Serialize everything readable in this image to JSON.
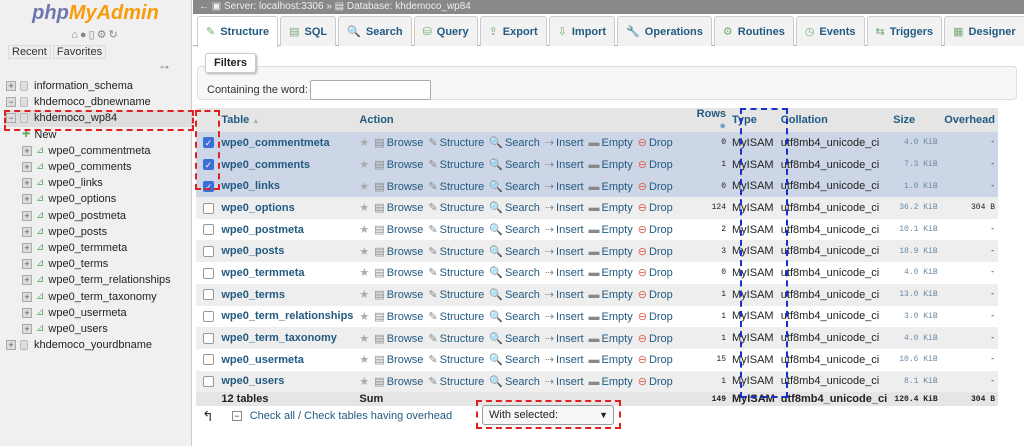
{
  "sidebar": {
    "logo_php": "php",
    "logo_ma": "MyAdmin",
    "recent": "Recent",
    "favorites": "Favorites",
    "link_icon": "chain-link-icon",
    "databases": [
      {
        "name": "information_schema",
        "expander": "+"
      },
      {
        "name": "khdemoco_dbnewname",
        "expander": "−"
      },
      {
        "name": "khdemoco_wp84",
        "expander": "−",
        "selected": true
      },
      {
        "name": "khdemoco_yourdbname",
        "expander": "+"
      }
    ],
    "new_label": "New",
    "tables": [
      "wpe0_commentmeta",
      "wpe0_comments",
      "wpe0_links",
      "wpe0_options",
      "wpe0_postmeta",
      "wpe0_posts",
      "wpe0_termmeta",
      "wpe0_terms",
      "wpe0_term_relationships",
      "wpe0_term_taxonomy",
      "wpe0_usermeta",
      "wpe0_users"
    ]
  },
  "breadcrumb": {
    "server": "Server: localhost:3306",
    "sep": "»",
    "database": "Database: khdemoco_wp84"
  },
  "tabs": [
    {
      "label": "Structure",
      "icon": "✎"
    },
    {
      "label": "SQL",
      "icon": "▤"
    },
    {
      "label": "Search",
      "icon": "🔍"
    },
    {
      "label": "Query",
      "icon": "⛁"
    },
    {
      "label": "Export",
      "icon": "⇪"
    },
    {
      "label": "Import",
      "icon": "⇩"
    },
    {
      "label": "Operations",
      "icon": "🔧"
    },
    {
      "label": "Routines",
      "icon": "⚙"
    },
    {
      "label": "Events",
      "icon": "◷"
    },
    {
      "label": "Triggers",
      "icon": "⇆"
    },
    {
      "label": "Designer",
      "icon": "▦"
    }
  ],
  "filters": {
    "legend": "Filters",
    "label": "Containing the word:",
    "value": ""
  },
  "table": {
    "headers": {
      "table": "Table",
      "sort": "▲",
      "action": "Action",
      "rows": "Rows",
      "type": "Type",
      "collation": "Collation",
      "size": "Size",
      "overhead": "Overhead"
    },
    "actions": {
      "browse": "Browse",
      "structure": "Structure",
      "search": "Search",
      "insert": "Insert",
      "empty": "Empty",
      "drop": "Drop"
    },
    "rows": [
      {
        "name": "wpe0_commentmeta",
        "rows": "0",
        "type": "MyISAM",
        "collation": "utf8mb4_unicode_ci",
        "size": "4.0 KiB",
        "overhead": "-",
        "checked": true
      },
      {
        "name": "wpe0_comments",
        "rows": "1",
        "type": "MyISAM",
        "collation": "utf8mb4_unicode_ci",
        "size": "7.3 KiB",
        "overhead": "-",
        "checked": true
      },
      {
        "name": "wpe0_links",
        "rows": "0",
        "type": "MyISAM",
        "collation": "utf8mb4_unicode_ci",
        "size": "1.0 KiB",
        "overhead": "-",
        "checked": true
      },
      {
        "name": "wpe0_options",
        "rows": "124",
        "type": "MyISAM",
        "collation": "utf8mb4_unicode_ci",
        "size": "36.2 KiB",
        "overhead": "304 B",
        "checked": false
      },
      {
        "name": "wpe0_postmeta",
        "rows": "2",
        "type": "MyISAM",
        "collation": "utf8mb4_unicode_ci",
        "size": "10.1 KiB",
        "overhead": "-",
        "checked": false
      },
      {
        "name": "wpe0_posts",
        "rows": "3",
        "type": "MyISAM",
        "collation": "utf8mb4_unicode_ci",
        "size": "18.9 KiB",
        "overhead": "-",
        "checked": false
      },
      {
        "name": "wpe0_termmeta",
        "rows": "0",
        "type": "MyISAM",
        "collation": "utf8mb4_unicode_ci",
        "size": "4.0 KiB",
        "overhead": "-",
        "checked": false
      },
      {
        "name": "wpe0_terms",
        "rows": "1",
        "type": "MyISAM",
        "collation": "utf8mb4_unicode_ci",
        "size": "13.0 KiB",
        "overhead": "-",
        "checked": false
      },
      {
        "name": "wpe0_term_relationships",
        "rows": "1",
        "type": "MyISAM",
        "collation": "utf8mb4_unicode_ci",
        "size": "3.0 KiB",
        "overhead": "-",
        "checked": false
      },
      {
        "name": "wpe0_term_taxonomy",
        "rows": "1",
        "type": "MyISAM",
        "collation": "utf8mb4_unicode_ci",
        "size": "4.0 KiB",
        "overhead": "-",
        "checked": false
      },
      {
        "name": "wpe0_usermeta",
        "rows": "15",
        "type": "MyISAM",
        "collation": "utf8mb4_unicode_ci",
        "size": "10.6 KiB",
        "overhead": "-",
        "checked": false
      },
      {
        "name": "wpe0_users",
        "rows": "1",
        "type": "MyISAM",
        "collation": "utf8mb4_unicode_ci",
        "size": "8.1 KiB",
        "overhead": "-",
        "checked": false
      }
    ],
    "footer": {
      "count": "12 tables",
      "sum": "Sum",
      "rows": "149",
      "type": "MyISAM",
      "collation": "utf8mb4_unicode_ci",
      "size": "120.4 KiB",
      "overhead": "304 B"
    }
  },
  "bottom": {
    "check_all": "Check all",
    "sep": " / ",
    "check_overhead": "Check tables having overhead",
    "with_selected": "With selected:"
  },
  "colors": {
    "link": "#235a81",
    "checked_row": "#ccd6e6",
    "highlight_red": "#e02020",
    "highlight_blue": "#1a2fd0"
  }
}
